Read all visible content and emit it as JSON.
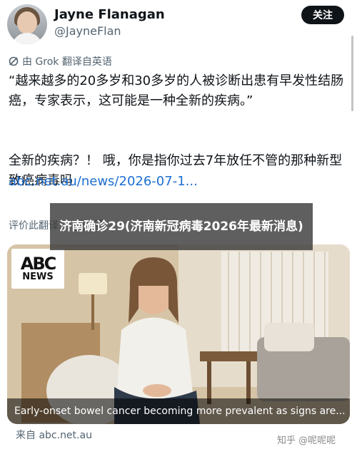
{
  "header": {
    "display_name": "Jayne Flanagan",
    "handle": "@JayneFlan",
    "follow_label": "关注"
  },
  "translation": {
    "label": "由 Grok 翻译自英语"
  },
  "post": {
    "paragraph1": "“越来越多的20多岁和30多岁的人被诊断出患有早发性结肠癌，专家表示，这可能是一种全新的疾病。”",
    "paragraph2": "全新的疾病？！ 哦，你是指你过去7年放任不管的那种新型致癌病毒吗",
    "link_text": "abc.net.au/news/2026-07-1..."
  },
  "rating": {
    "label": "评价此翻译："
  },
  "overlay": {
    "title": "济南确诊29(济南新冠病毒2026年最新消息)"
  },
  "card": {
    "logo_mark": "ABC",
    "logo_text": "NEWS",
    "caption": "Early-onset bowel cancer becoming more prevalent as signs are..."
  },
  "footer": {
    "source": "来自 abc.net.au",
    "watermark": "知乎 @呢呢呢"
  },
  "colors": {
    "link": "#1d6fd1",
    "follow_bg": "#0f1419",
    "muted": "#536471"
  }
}
